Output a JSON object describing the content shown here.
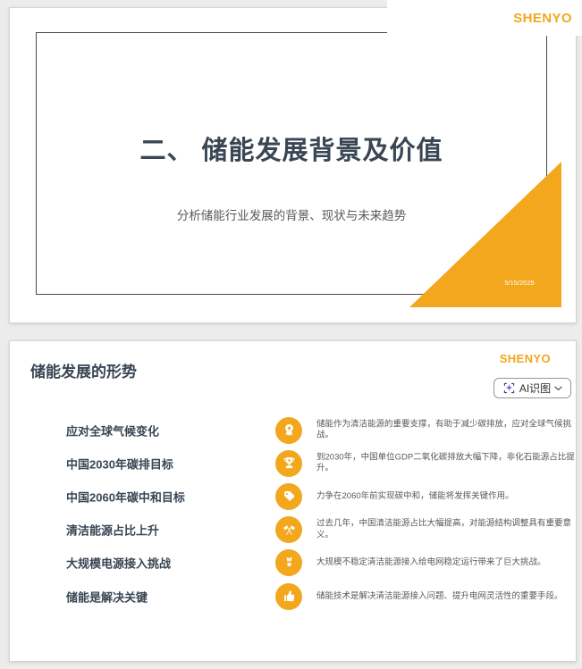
{
  "colors": {
    "accent": "#F2A71D",
    "ink": "#3A4654",
    "muted": "#595959",
    "page_bg": "#ececec"
  },
  "brand": {
    "name": "SHENYO"
  },
  "slide1": {
    "title": "二、 储能发展背景及价值",
    "subtitle": "分析储能行业发展的背景、现状与未来趋势",
    "date": "5/15/2025",
    "accent_shape": "corner-triangle"
  },
  "slide2": {
    "title": "储能发展的形势",
    "ai_button": {
      "label": "AI识图",
      "icon": "ai-scan-sparkle-icon",
      "chevron": "chevron-down-icon"
    },
    "items": [
      {
        "label": "应对全球气候变化",
        "icon": "award-ribbon-icon",
        "desc": "储能作为清洁能源的重要支撑，有助于减少碳排放，应对全球气候挑战。"
      },
      {
        "label": "中国2030年碳排目标",
        "icon": "trophy-icon",
        "desc": "到2030年，中国单位GDP二氧化碳排放大幅下降，非化石能源占比提升。"
      },
      {
        "label": "中国2060年碳中和目标",
        "icon": "price-tag-icon",
        "desc": "力争在2060年前实现碳中和，储能将发挥关键作用。"
      },
      {
        "label": "清洁能源占比上升",
        "icon": "crossed-flags-icon",
        "desc": "过去几年，中国清洁能源占比大幅提高，对能源结构调整具有重要意义。"
      },
      {
        "label": "大规模电源接入挑战",
        "icon": "medal-icon",
        "desc": "大规模不稳定清洁能源接入给电网稳定运行带来了巨大挑战。"
      },
      {
        "label": "储能是解决关键",
        "icon": "thumbs-up-icon",
        "desc": "储能技术是解决清洁能源接入问题、提升电网灵活性的重要手段。"
      }
    ]
  }
}
